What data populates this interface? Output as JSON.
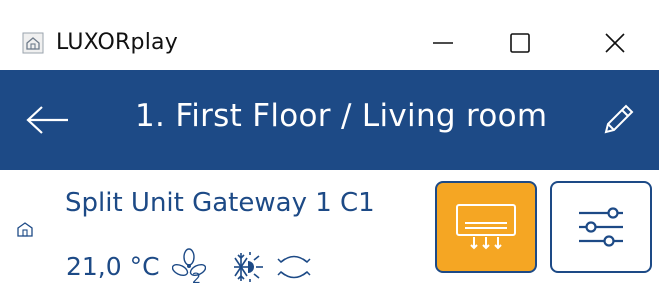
{
  "window": {
    "title": "LUXORplay",
    "icons": {
      "app": "home-icon",
      "minimize": "minimize-icon",
      "maximize": "maximize-icon",
      "close": "close-icon"
    }
  },
  "header": {
    "title": "1. First Floor / Living room",
    "back_icon": "arrow-left-icon",
    "edit_icon": "pencil-icon",
    "background": "#1d4a86"
  },
  "device": {
    "name": "Split Unit Gateway 1 C1",
    "temperature": "21,0 °C",
    "fan_level": "2",
    "icons": {
      "room": "room-icon",
      "fan": "fan-icon",
      "mode": "cool-heat-mode-icon",
      "swing": "swing-icon",
      "ac": "air-conditioner-icon",
      "settings": "sliders-icon"
    },
    "ac_button_color": "#f5a623"
  }
}
